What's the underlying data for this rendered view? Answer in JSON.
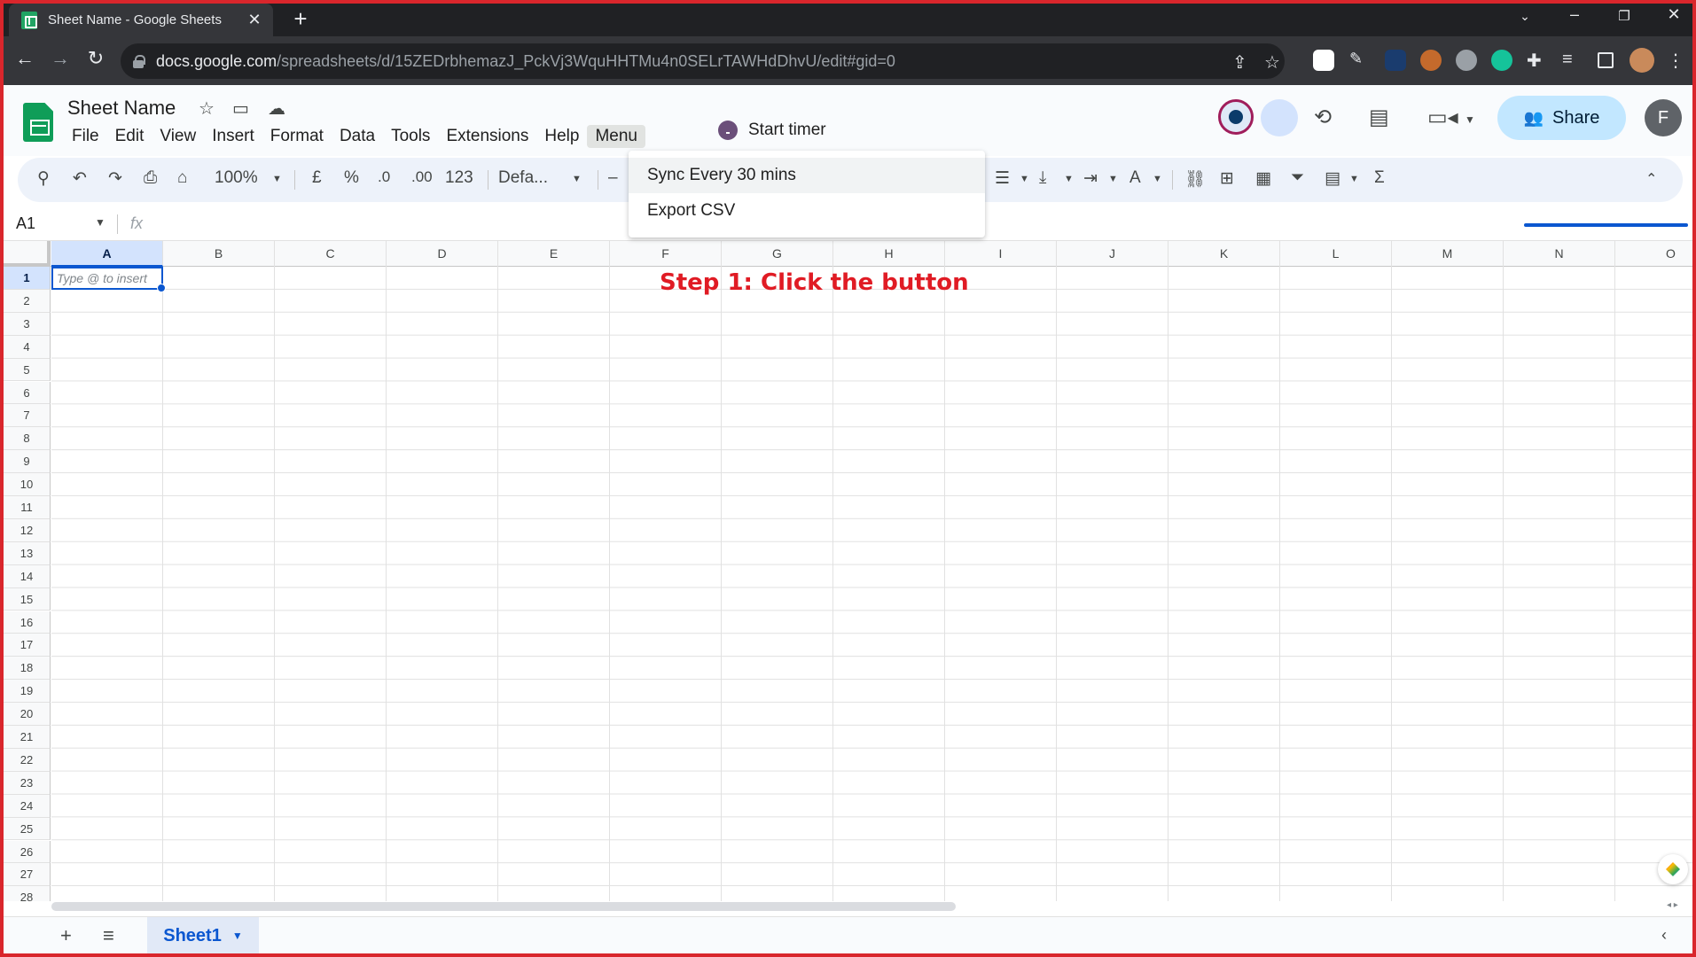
{
  "browser": {
    "tab_title": "Sheet Name - Google Sheets",
    "tab_close": "✕",
    "new_tab": "+",
    "url_host": "docs.google.com",
    "url_path": "/spreadsheets/d/15ZEDrbhemazJ_PckVj3WquHHTMu4n0SELrTAWHdDhvU/edit#gid=0"
  },
  "sheets": {
    "doc_title": "Sheet Name",
    "menu": [
      "File",
      "Edit",
      "View",
      "Insert",
      "Format",
      "Data",
      "Tools",
      "Extensions",
      "Help",
      "Menu"
    ],
    "timer_label": "Start timer",
    "share_label": "Share",
    "avatar_initial": "F"
  },
  "toolbar": {
    "zoom": "100%",
    "currency": "£",
    "percent": "%",
    "dec_decrease": ".0",
    "dec_increase": ".00",
    "number_format": "123",
    "font": "Defa...",
    "minus": "–"
  },
  "dropdown": {
    "items": [
      "Sync Every 30 mins",
      "Export CSV"
    ]
  },
  "formula_bar": {
    "cell_ref": "A1",
    "fx": "fx"
  },
  "grid": {
    "columns": [
      "A",
      "B",
      "C",
      "D",
      "E",
      "F",
      "G",
      "H",
      "I",
      "J",
      "K",
      "L",
      "M",
      "N",
      "O"
    ],
    "rows": [
      "1",
      "2",
      "3",
      "4",
      "5",
      "6",
      "7",
      "8",
      "9",
      "10",
      "11",
      "12",
      "13",
      "14",
      "15",
      "16",
      "17",
      "18",
      "19",
      "20",
      "21",
      "22",
      "23",
      "24",
      "25",
      "26",
      "27",
      "28"
    ],
    "active_cell_hint": "Type @ to insert",
    "annotation": "Step 1: Click the button"
  },
  "sheet_tabs": {
    "active": "Sheet1",
    "add": "+",
    "list": "≡"
  },
  "colors": {
    "accent": "#0b57d0",
    "annotation": "#e01b24",
    "sheets_green": "#0f9d58",
    "frame": "#d9262c"
  }
}
